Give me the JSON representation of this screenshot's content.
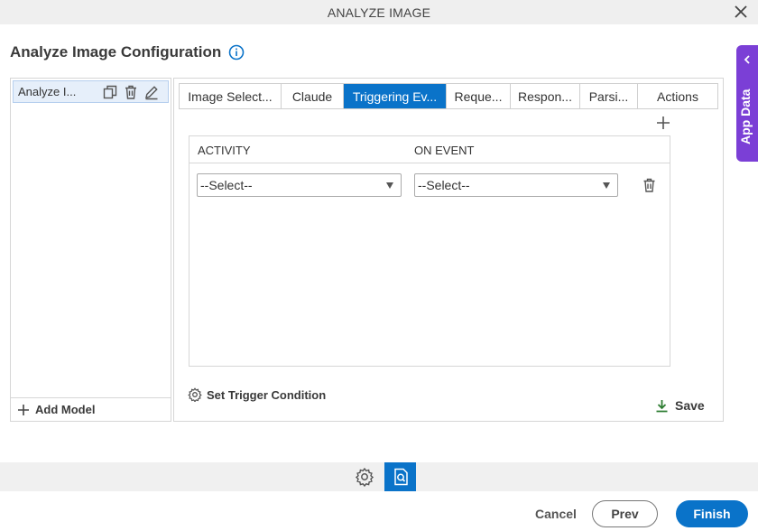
{
  "window": {
    "title": "ANALYZE IMAGE",
    "close_icon": "close-icon"
  },
  "page": {
    "heading": "Analyze Image Configuration",
    "info_icon": "info-icon"
  },
  "side_tab": {
    "label": "App Data",
    "icon": "chevron-left-icon",
    "color": "#7b3fd6"
  },
  "models": {
    "items": [
      {
        "label": "Analyze I..."
      }
    ],
    "add_label": "Add Model"
  },
  "tabs": [
    {
      "label": "Image Select..."
    },
    {
      "label": "Claude"
    },
    {
      "label": "Triggering Ev...",
      "active": true
    },
    {
      "label": "Reque..."
    },
    {
      "label": "Respon..."
    },
    {
      "label": "Parsi..."
    },
    {
      "label": "Actions"
    }
  ],
  "grid": {
    "columns": [
      "ACTIVITY",
      "ON EVENT"
    ],
    "rows": [
      {
        "activity": "--Select--",
        "on_event": "--Select--"
      }
    ]
  },
  "trigger": {
    "label": "Set Trigger Condition"
  },
  "save": {
    "label": "Save"
  },
  "footer": {
    "cancel": "Cancel",
    "prev": "Prev",
    "finish": "Finish"
  },
  "colors": {
    "accent": "#0a73c9",
    "save_icon": "#2e7d32"
  }
}
